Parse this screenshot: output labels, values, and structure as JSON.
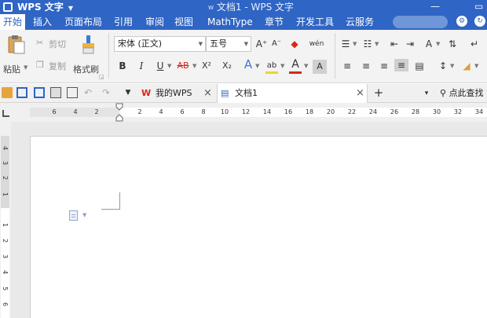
{
  "title_bar": {
    "app_name": "WPS 文字",
    "document_title": "文档1 - WPS 文字",
    "doc_mark": "W"
  },
  "menu": {
    "items": [
      "开始",
      "插入",
      "页面布局",
      "引用",
      "审阅",
      "视图",
      "MathType",
      "章节",
      "开发工具",
      "云服务"
    ],
    "active": "开始"
  },
  "ribbon": {
    "paste_label": "粘贴",
    "cut_label": "剪切",
    "copy_label": "复制",
    "format_painter_label": "格式刷",
    "font_name": "宋体 (正文)",
    "font_size": "五号",
    "grow_font": "A⁺",
    "shrink_font": "A⁻",
    "phonetic_glyph": "wén",
    "bold": "B",
    "italic": "I",
    "underline": "U",
    "strikethrough": "AB",
    "superscript": "X²",
    "subscript": "X₂",
    "text_effect": "A",
    "highlight": "ab",
    "font_color": "A",
    "char_shading": "A",
    "colors": {
      "highlight_bar": "#f7d02c",
      "font_color_bar": "#d9261c",
      "shading_bar": "#d0d0d0",
      "accent": "#2f65c4"
    }
  },
  "quick_access": {
    "tabs": [
      {
        "label": "我的WPS",
        "icon": "wps-logo-icon"
      },
      {
        "label": "文档1",
        "icon": "document-icon"
      }
    ],
    "search_label": "点此查找"
  },
  "ruler": {
    "numbers": [
      "6",
      "4",
      "2",
      "2",
      "4",
      "6",
      "8",
      "10",
      "12",
      "14",
      "16",
      "18",
      "20",
      "22",
      "24",
      "26",
      "28",
      "30",
      "32",
      "34"
    ],
    "vertical_numbers": [
      "4",
      "3",
      "2",
      "1",
      "1",
      "2",
      "3",
      "4",
      "5",
      "6"
    ]
  }
}
